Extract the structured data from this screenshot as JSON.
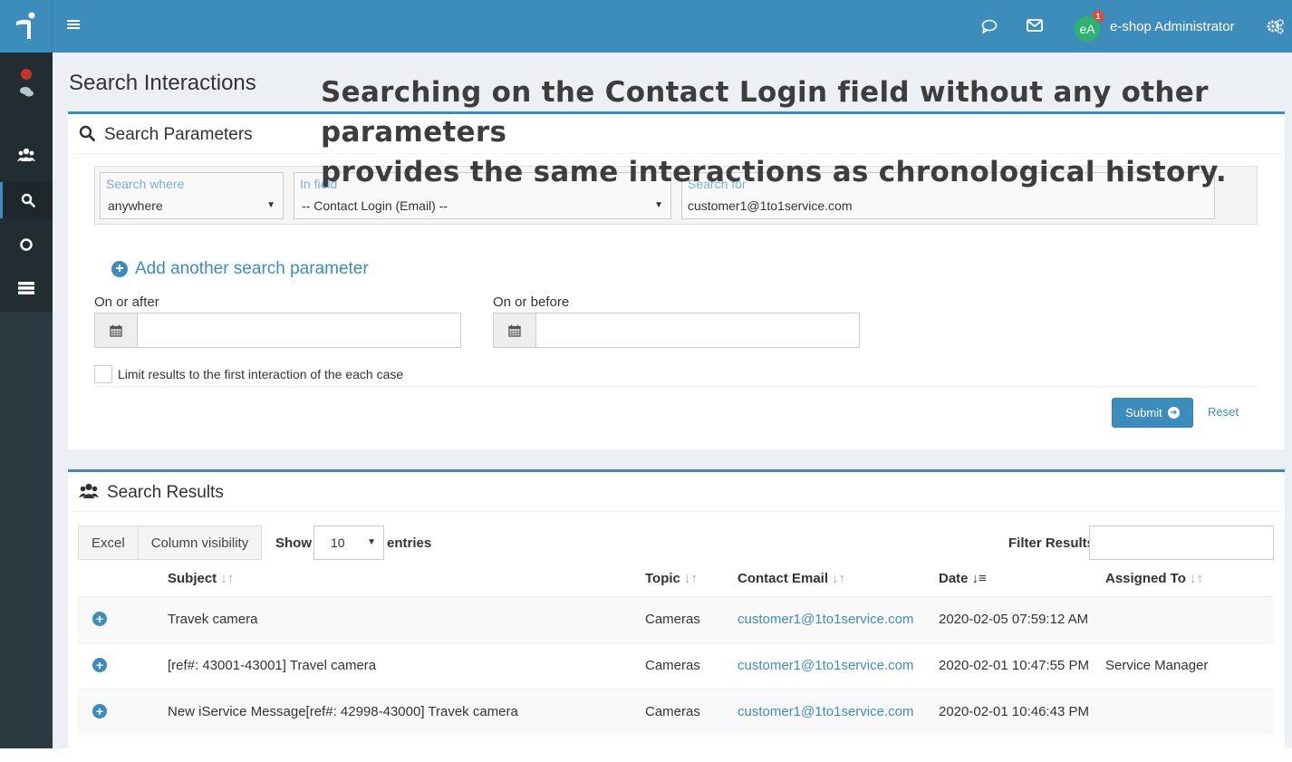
{
  "header": {
    "user_initials": "eA",
    "user_name": "e-shop Administrator",
    "mail_count": "1"
  },
  "page": {
    "title": "Search Interactions",
    "annotation_line1": "Searching on the Contact Login field without any other parameters",
    "annotation_line2": "provides the same interactions as chronological history."
  },
  "search_params": {
    "box_title": "Search Parameters",
    "where_label": "Search where",
    "where_value": "anywhere",
    "field_label": "In field",
    "field_value": "-- Contact Login (Email) --",
    "for_label": "Search for",
    "for_value": "customer1@1to1service.com",
    "add_param": "Add another search parameter",
    "after_label": "On or after",
    "before_label": "On or before",
    "after_value": "",
    "before_value": "",
    "limit_label": "Limit results to the first interaction of the each case",
    "submit": "Submit",
    "reset": "Reset"
  },
  "results": {
    "box_title": "Search Results",
    "excel": "Excel",
    "column_visibility": "Column visibility",
    "show": "Show",
    "page_size": "10",
    "entries": "entries",
    "filter_label": "Filter Results",
    "filter_value": "",
    "columns": [
      "Subject",
      "Topic",
      "Contact Email",
      "Date",
      "Assigned To"
    ],
    "rows": [
      {
        "subject": "Travek camera",
        "topic": "Cameras",
        "email": "customer1@1to1service.com",
        "date": "2020-02-05 07:59:12 AM",
        "assigned": ""
      },
      {
        "subject": "[ref#: 43001-43001] Travel camera",
        "topic": "Cameras",
        "email": "customer1@1to1service.com",
        "date": "2020-02-01 10:47:55 PM",
        "assigned": "Service Manager"
      },
      {
        "subject": "New iService Message[ref#: 42998-43000] Travek camera",
        "topic": "Cameras",
        "email": "customer1@1to1service.com",
        "date": "2020-02-01 10:46:43 PM",
        "assigned": ""
      }
    ]
  },
  "colors": {
    "primary": "#3c8dbc",
    "sidebar": "#222d32",
    "content_bg": "#ecf0f5",
    "avatar": "#2db36b",
    "badge": "#dd4b39",
    "status_dot": "#c9302c"
  }
}
